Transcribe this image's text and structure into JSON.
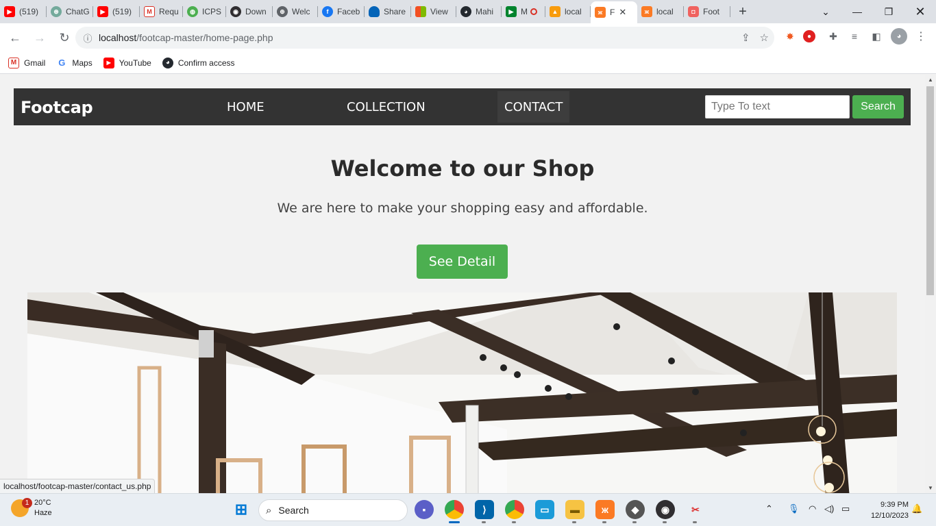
{
  "browser": {
    "tabs": [
      {
        "label": "(519)",
        "icon": "youtube-icon",
        "color": "#ff0000"
      },
      {
        "label": "ChatG",
        "icon": "chatgpt-icon",
        "color": "#74aa9c"
      },
      {
        "label": "(519)",
        "icon": "youtube-icon",
        "color": "#ff0000"
      },
      {
        "label": "Requ",
        "icon": "gmail-icon",
        "color": "#d93025"
      },
      {
        "label": "ICPS",
        "icon": "globe-green-icon",
        "color": "#4caf50"
      },
      {
        "label": "Down",
        "icon": "obs-icon",
        "color": "#302e31"
      },
      {
        "label": "Welc",
        "icon": "globe-icon",
        "color": "#5f6368"
      },
      {
        "label": "Faceb",
        "icon": "facebook-icon",
        "color": "#1877f2"
      },
      {
        "label": "Share",
        "icon": "onedrive-icon",
        "color": "#0364b8"
      },
      {
        "label": "View",
        "icon": "microsoft-icon",
        "color": "#f25022"
      },
      {
        "label": "Mahi",
        "icon": "github-icon",
        "color": "#24292f"
      },
      {
        "label": "M",
        "icon": "meet-icon",
        "color": "#00832d"
      },
      {
        "label": "local",
        "icon": "phpmyadmin-icon",
        "color": "#f89c0e"
      },
      {
        "label": "F",
        "icon": "xampp-icon",
        "color": "#fb7a24",
        "active": true
      },
      {
        "label": "local",
        "icon": "xampp-icon",
        "color": "#fb7a24"
      },
      {
        "label": "Foot",
        "icon": "footcap-icon",
        "color": "#f0625f"
      }
    ],
    "close_tab_glyph": "✕",
    "new_tab_glyph": "+",
    "address": {
      "host": "localhost",
      "path": "/footcap-master/home-page.php"
    },
    "bookmarks": [
      {
        "label": "Gmail",
        "icon": "gmail-icon"
      },
      {
        "label": "Maps",
        "icon": "google-icon"
      },
      {
        "label": "YouTube",
        "icon": "youtube-icon"
      },
      {
        "label": "Confirm access",
        "icon": "github-icon"
      }
    ],
    "status_url": "localhost/footcap-master/contact_us.php"
  },
  "site": {
    "brand": "Footcap",
    "nav": {
      "home": "HOME",
      "collection": "COLLECTION",
      "contact": "CONTACT"
    },
    "search": {
      "placeholder": "Type To text",
      "button": "Search"
    },
    "hero": {
      "title": "Welcome to our Shop",
      "subtitle": "We are here to make your shopping easy and affordable.",
      "button": "See Detail"
    },
    "colors": {
      "nav_bg": "#333333",
      "accent": "#4caf50",
      "page_bg": "#f2f2f2"
    }
  },
  "taskbar": {
    "weather": {
      "temp": "20°C",
      "condition": "Haze",
      "badge": "1"
    },
    "search_label": "Search",
    "time": "9:39 PM",
    "date": "12/10/2023"
  }
}
